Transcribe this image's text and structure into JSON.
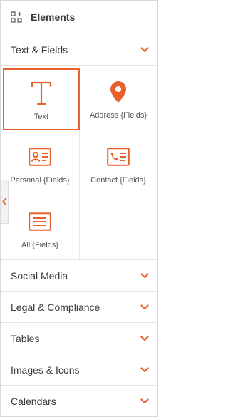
{
  "header": {
    "title": "Elements",
    "icon": "grid-plus-icon"
  },
  "sections": {
    "text_fields": {
      "label": "Text & Fields",
      "expanded": true
    },
    "collapsed": [
      {
        "label": "Social Media"
      },
      {
        "label": "Legal & Compliance"
      },
      {
        "label": "Tables"
      },
      {
        "label": "Images & Icons"
      },
      {
        "label": "Calendars"
      }
    ]
  },
  "tiles": [
    {
      "label": "Text",
      "icon": "text-t-icon",
      "selected": true
    },
    {
      "label": "Address {Fields}",
      "icon": "map-pin-icon"
    },
    {
      "label": "Personal {Fields}",
      "icon": "id-card-icon"
    },
    {
      "label": "Contact {Fields}",
      "icon": "contact-card-icon"
    },
    {
      "label": "All {Fields}",
      "icon": "list-box-icon"
    }
  ],
  "colors": {
    "accent": "#e8602c",
    "border": "#e3e3e3",
    "text": "#3a3a3a"
  }
}
